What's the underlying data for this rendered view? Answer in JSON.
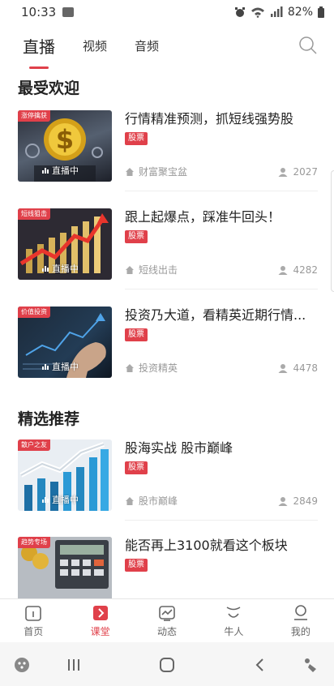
{
  "status_bar": {
    "time": "10:33",
    "battery": "82%"
  },
  "tabs": [
    {
      "label": "直播"
    },
    {
      "label": "视频"
    },
    {
      "label": "音频"
    }
  ],
  "sections": {
    "popular_title": "最受欢迎",
    "featured_title": "精选推荐"
  },
  "live_label": "直播中",
  "cards": [
    {
      "tag": "涨停擒获",
      "title": "行情精准预测，抓短线强势股",
      "category": "股票",
      "host": "财富聚宝盆",
      "count": "2027"
    },
    {
      "tag": "短线狙击",
      "title": "跟上起爆点，踩准牛回头！",
      "category": "股票",
      "host": "短线出击",
      "count": "4282"
    },
    {
      "tag": "价值投资",
      "title": "投资乃大道，看精英近期行情...",
      "category": "股票",
      "host": "投资精英",
      "count": "4478"
    },
    {
      "tag": "散户之友",
      "title": "股海实战 股市巅峰",
      "category": "股票",
      "host": "股市巅峰",
      "count": "2849"
    },
    {
      "tag": "趋势专场",
      "title": "能否再上3100就看这个板块",
      "category": "股票",
      "host": "",
      "count": ""
    }
  ],
  "bottom_nav": [
    {
      "label": "首页"
    },
    {
      "label": "课堂"
    },
    {
      "label": "动态"
    },
    {
      "label": "牛人"
    },
    {
      "label": "我的"
    }
  ],
  "colors": {
    "accent": "#e0404a",
    "text": "#222222",
    "muted": "#999999"
  }
}
